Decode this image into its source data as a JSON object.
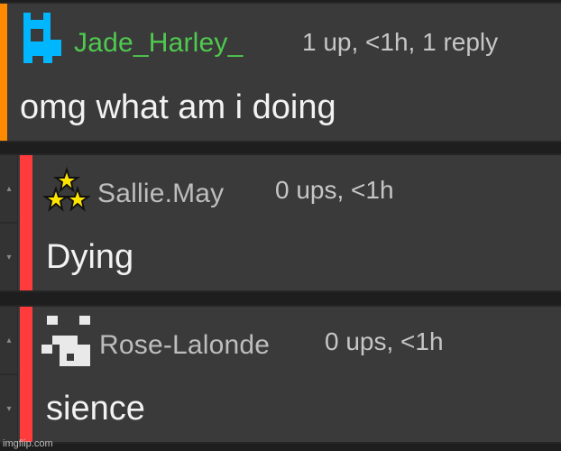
{
  "comments": [
    {
      "username": "Jade_Harley_",
      "meta": "1 up, <1h, 1 reply",
      "text": "omg what am i doing",
      "username_color": "#4fc94f",
      "accent_color": "#ff8a00",
      "avatar_icon": "pixel-dog-icon",
      "avatar_color": "#00b7ff"
    },
    {
      "username": "Sallie.May",
      "meta": "0 ups, <1h",
      "text": "Dying",
      "username_color": "#bdbdbd",
      "accent_color": "#ff3b3b",
      "avatar_icon": "three-stars-icon",
      "avatar_color": "#ffe400",
      "vote_up_icon": "upvote-arrow-icon",
      "vote_down_icon": "downvote-arrow-icon"
    },
    {
      "username": "Rose-Lalonde",
      "meta": "0 ups, <1h",
      "text": "sience",
      "username_color": "#bdbdbd",
      "accent_color": "#ff3b3b",
      "avatar_icon": "pixel-face-icon",
      "avatar_color": "#e9e9e9",
      "vote_up_icon": "upvote-arrow-icon",
      "vote_down_icon": "downvote-arrow-icon"
    }
  ],
  "watermark": "imgflip.com"
}
